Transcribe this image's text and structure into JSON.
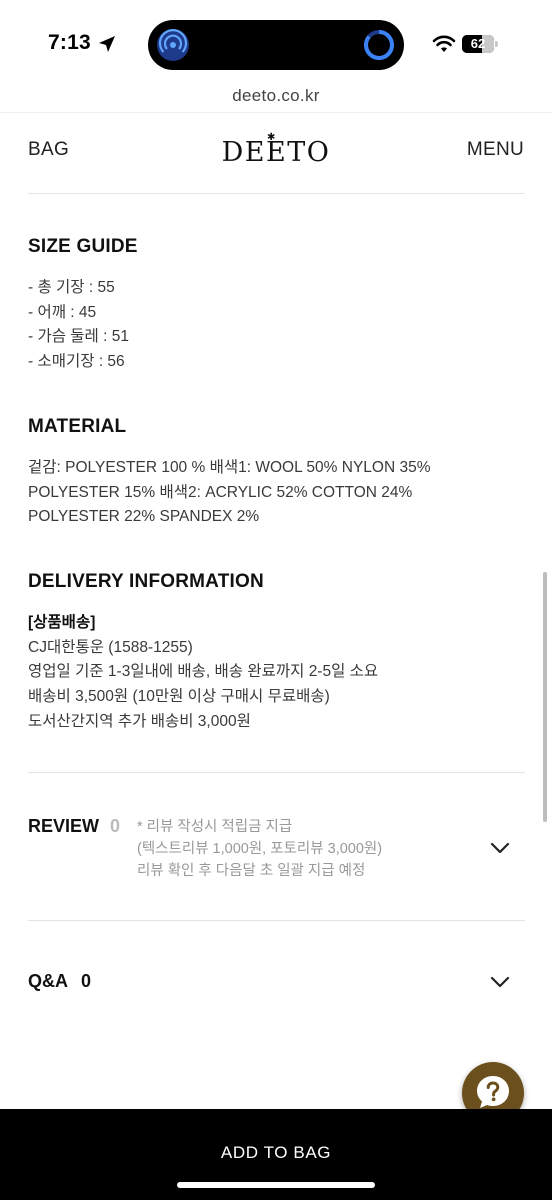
{
  "status_bar": {
    "time": "7:13",
    "battery": "62",
    "battery_level": 0.62
  },
  "browser": {
    "url": "deeto.co.kr"
  },
  "header": {
    "bag_label": "BAG",
    "logo": "DEETO",
    "menu_label": "MENU"
  },
  "size_guide": {
    "title": "SIZE GUIDE",
    "lines": [
      "- 총 기장 : 55",
      "- 어깨 : 45",
      "- 가슴 둘레 : 51",
      "- 소매기장 : 56"
    ]
  },
  "material": {
    "title": "MATERIAL",
    "lines": [
      "겉감: POLYESTER 100 % 배색1: WOOL 50% NYLON 35%",
      "POLYESTER 15% 배색2: ACRYLIC 52% COTTON 24%",
      "POLYESTER 22% SPANDEX 2%"
    ]
  },
  "delivery": {
    "title": "DELIVERY INFORMATION",
    "heading": "[상품배송]",
    "lines": [
      "CJ대한통운 (1588-1255)",
      "영업일 기준 1-3일내에 배송, 배송 완료까지 2-5일 소요",
      "배송비 3,500원 (10만원 이상 구매시 무료배송)",
      "도서산간지역 추가 배송비 3,000원"
    ]
  },
  "review": {
    "title": "REVIEW",
    "count": "0",
    "notes": [
      "* 리뷰 작성시 적립금 지급",
      "(텍스트리뷰 1,000원, 포토리뷰 3,000원)",
      "리뷰 확인 후 다음달 초 일괄 지급 예정"
    ]
  },
  "qa": {
    "title": "Q&A",
    "count": "0"
  },
  "bottom": {
    "add_to_bag": "ADD TO BAG"
  },
  "icons": {
    "location": "location-arrow-icon",
    "wifi": "wifi-icon",
    "help": "question-icon",
    "chevron": "chevron-down-icon"
  },
  "colors": {
    "help_button": "#6b4f1d",
    "bottom_bar": "#000000",
    "island_accent": "#3b82f6"
  }
}
